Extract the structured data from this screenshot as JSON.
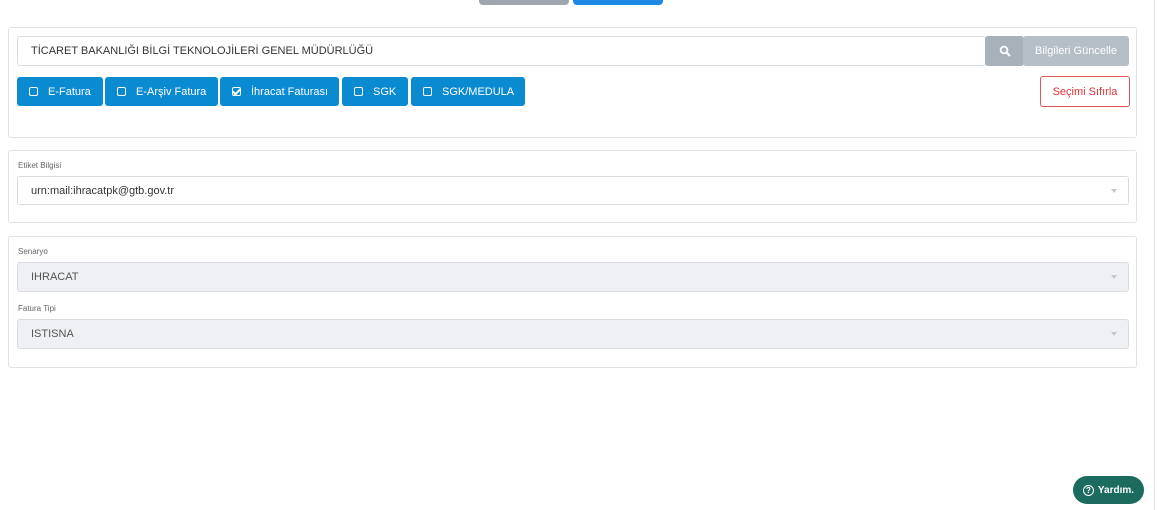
{
  "company_name": "TİCARET BAKANLIĞI BİLGİ TEKNOLOJİLERİ GENEL MÜDÜRLÜĞÜ",
  "update_button": "Bilgileri Güncelle",
  "options": [
    {
      "label": "E-Fatura",
      "checked": false
    },
    {
      "label": "E-Arşiv Fatura",
      "checked": false
    },
    {
      "label": "İhracat Faturası",
      "checked": true
    },
    {
      "label": "SGK",
      "checked": false
    },
    {
      "label": "SGK/MEDULA",
      "checked": false
    }
  ],
  "reset_button": "Seçimi Sıfırla",
  "tag": {
    "label": "Etiket Bilgisi",
    "value": "urn:mail:ihracatpk@gtb.gov.tr"
  },
  "scenario": {
    "label": "Senaryo",
    "value": "IHRACAT"
  },
  "invoice_type": {
    "label": "Fatura Tipi",
    "value": "ISTISNA"
  },
  "help_button": "Yardım.",
  "help_icon_glyph": "?",
  "colors": {
    "primary": "#0a8ad1",
    "danger": "#d33333",
    "help": "#1b6b5e"
  }
}
